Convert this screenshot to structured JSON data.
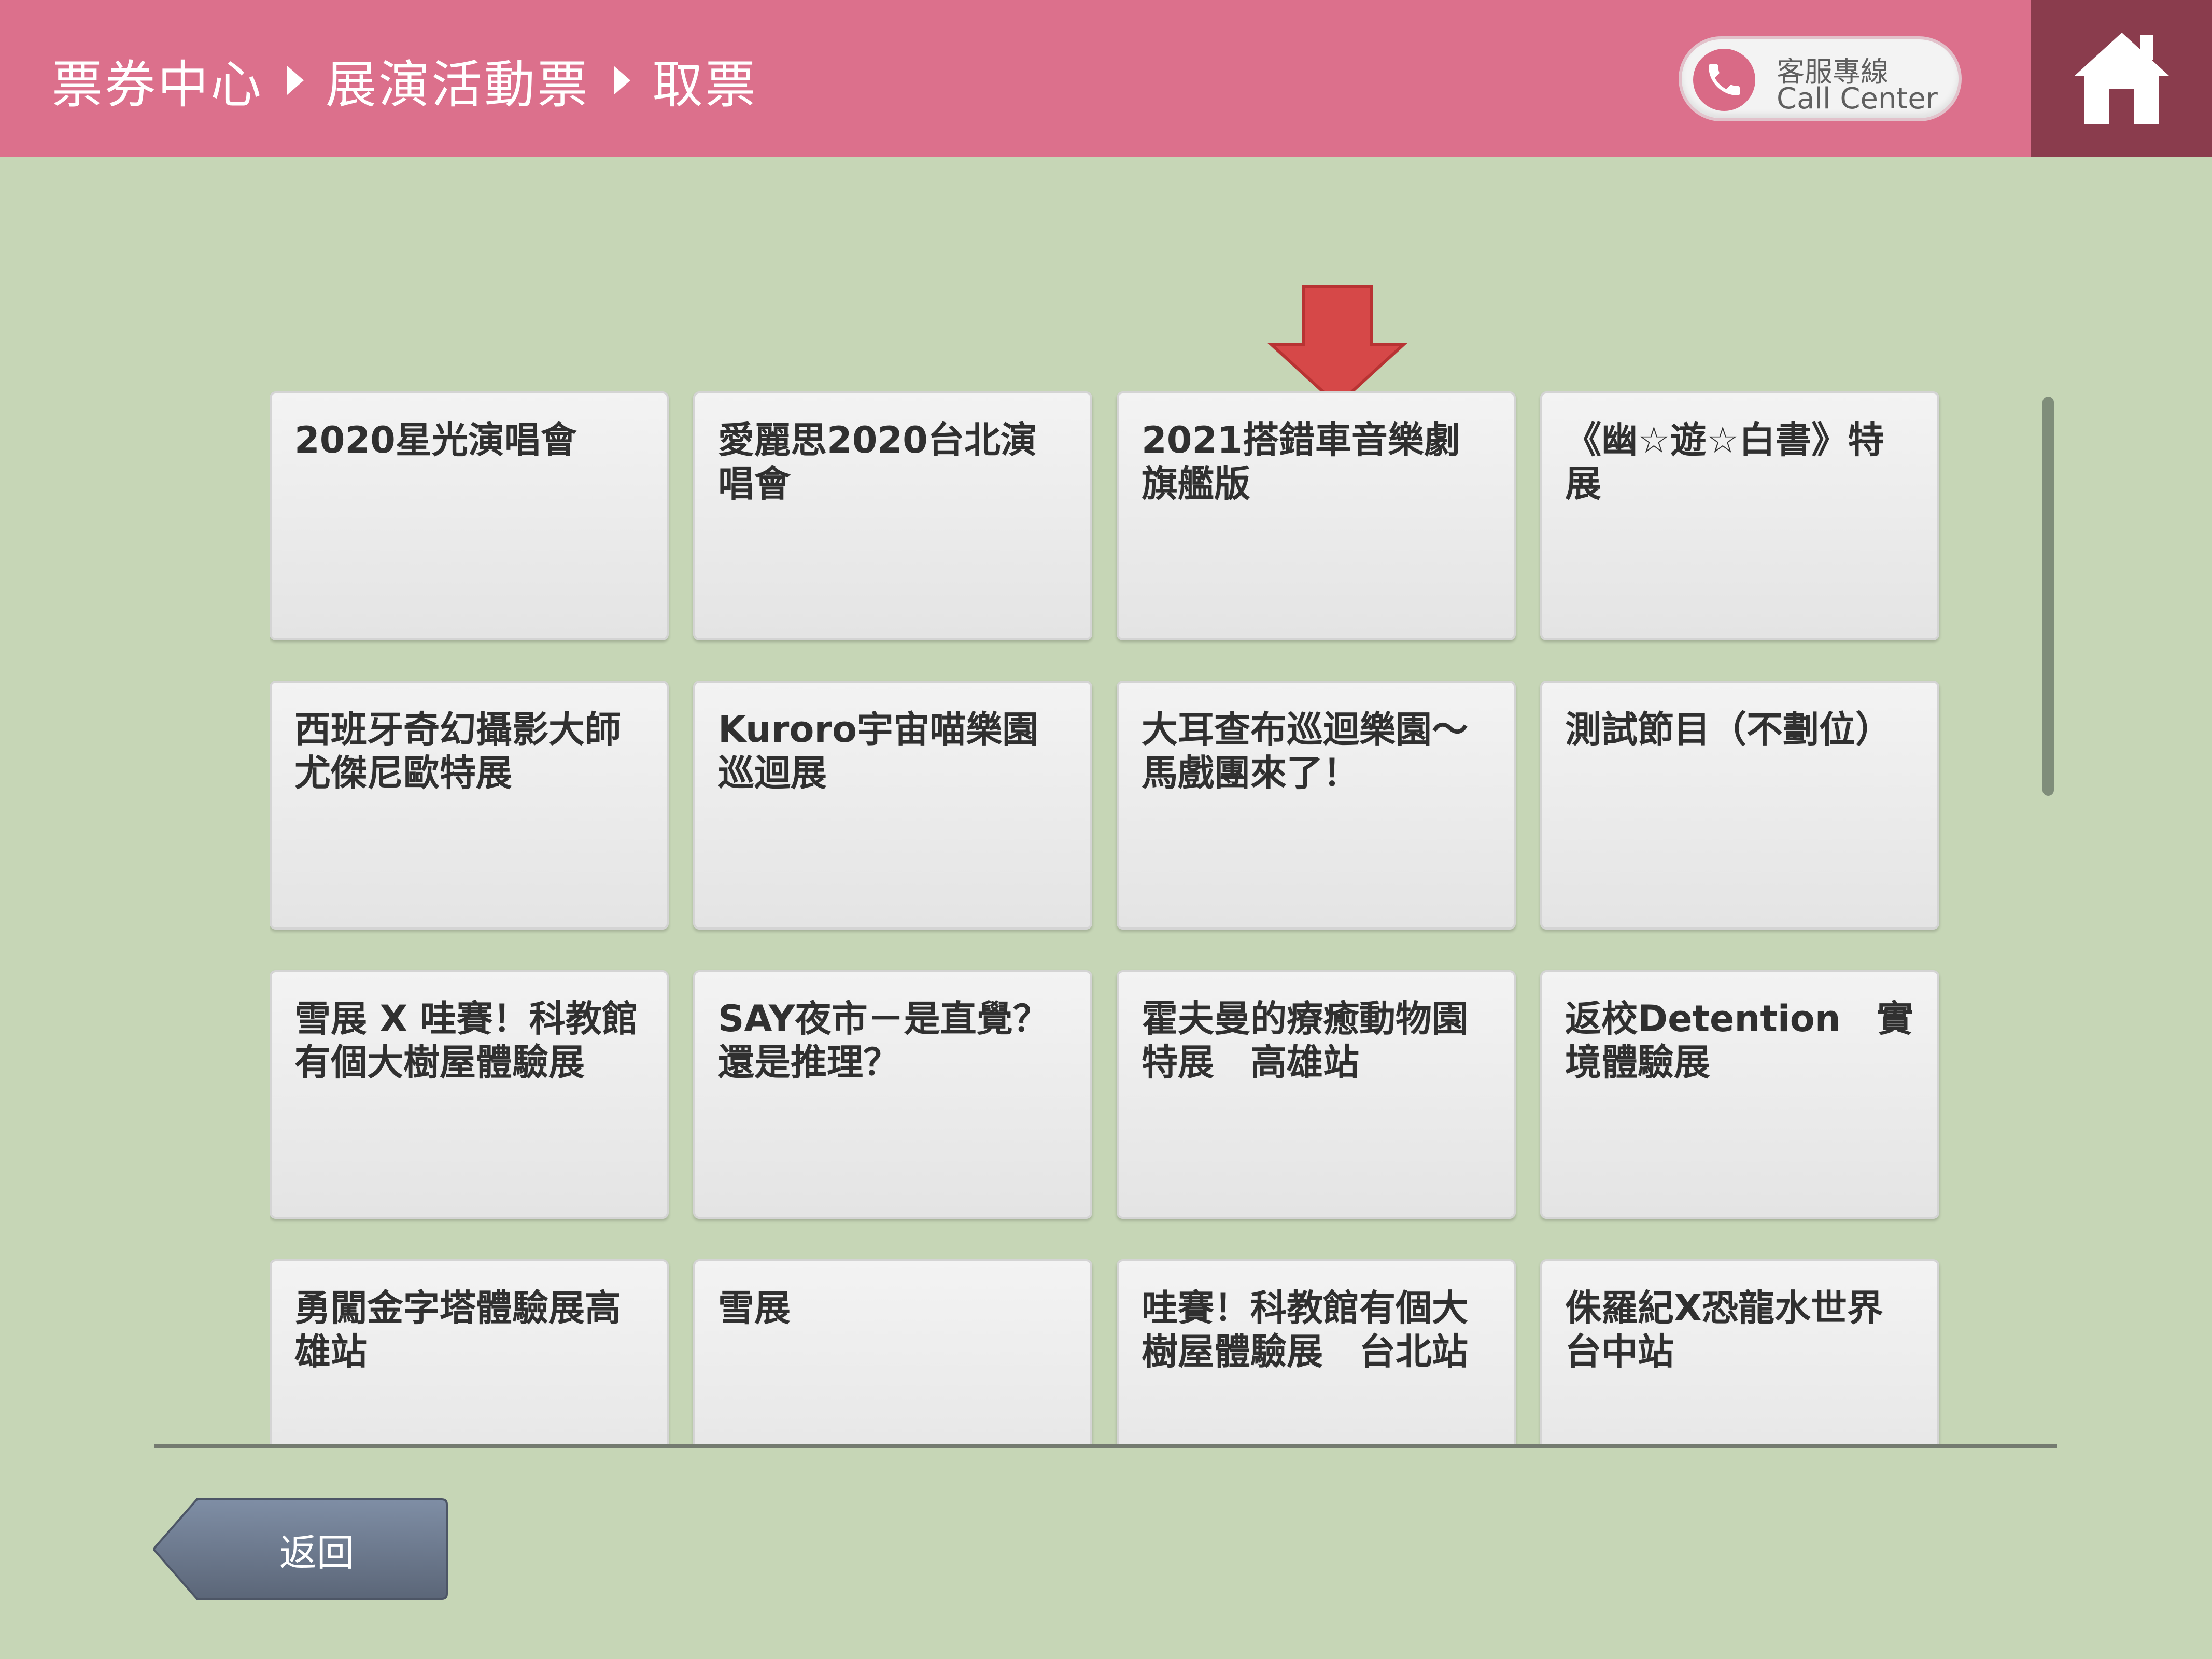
{
  "header": {
    "breadcrumb": [
      "票券中心",
      "展演活動票",
      "取票"
    ],
    "call_center": {
      "line1": "客服專線",
      "line2": "Call Center"
    }
  },
  "colors": {
    "header": "#dc708c",
    "home": "#8a3c4d",
    "background": "#c6d6b6",
    "arrow": "#d64848"
  },
  "icons": {
    "call": "phone-icon",
    "home": "home-icon",
    "pointer": "down-arrow-icon",
    "back": "back-arrow-icon"
  },
  "events": [
    "2020星光演唱會",
    "愛麗思2020台北演唱會",
    "2021搭錯車音樂劇旗艦版",
    "《幽☆遊☆白書》特展",
    "西班牙奇幻攝影大師尤傑尼歐特展",
    "Kuroro宇宙喵樂園巡迴展",
    "大耳查布巡迴樂園～馬戲團來了！",
    "測試節目（不劃位）",
    "雪展 X 哇賽！科教館有個大樹屋體驗展",
    "SAY夜市－是直覺？還是推理？",
    "霍夫曼的療癒動物園特展　高雄站",
    "返校Detention　實境體驗展",
    "勇闖金字塔體驗展高雄站",
    "雪展",
    "哇賽！科教館有個大樹屋體驗展　台北站",
    "侏羅紀X恐龍水世界台中站"
  ],
  "footer": {
    "back_label": "返回"
  }
}
